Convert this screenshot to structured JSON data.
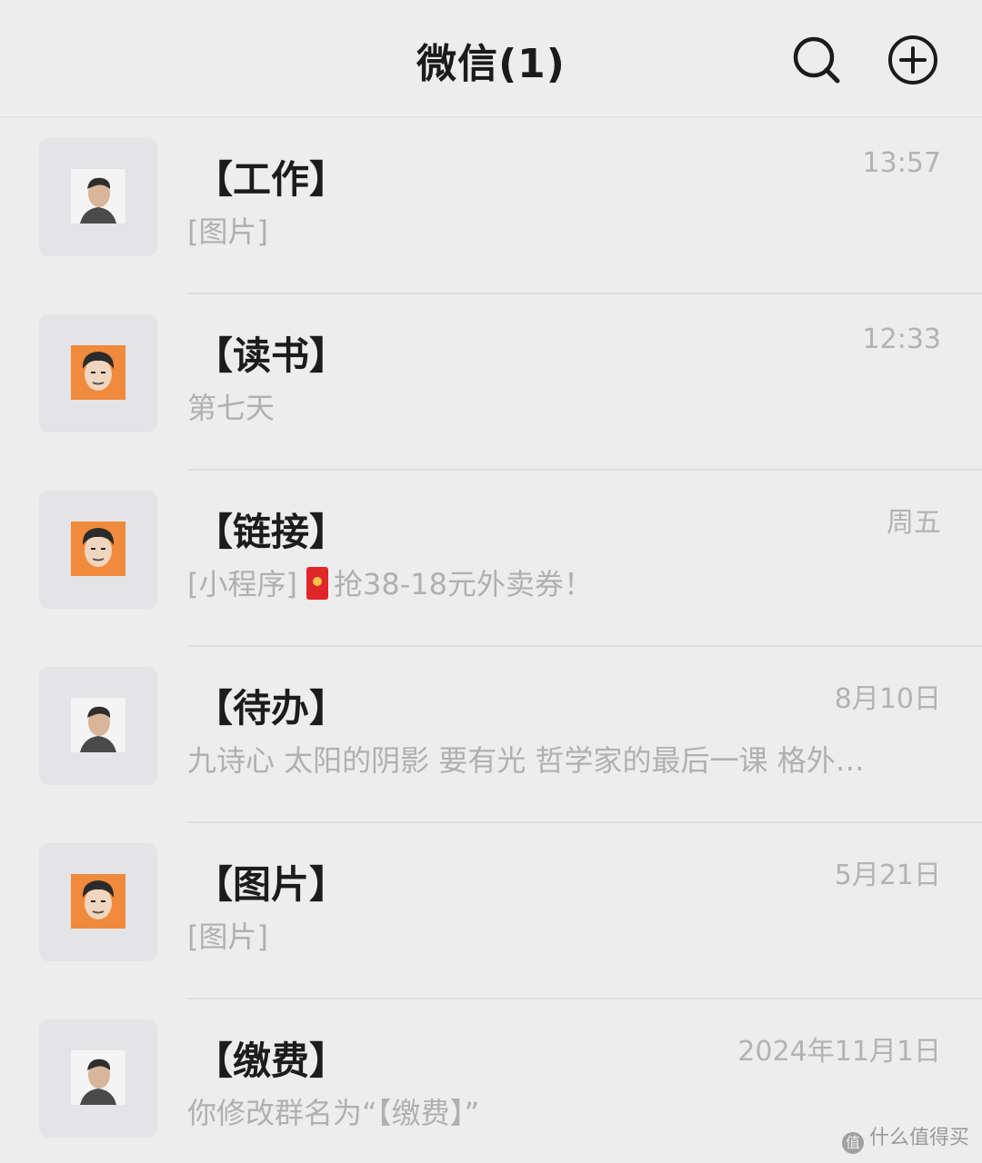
{
  "header": {
    "title": "微信(1)",
    "search_icon": "search-icon",
    "add_icon": "plus-circle-icon"
  },
  "chats": [
    {
      "name": "【工作】",
      "time": "13:57",
      "preview": "[图片]",
      "avatar": "gray"
    },
    {
      "name": "【读书】",
      "time": "12:33",
      "preview": "第七天",
      "avatar": "orange"
    },
    {
      "name": "【链接】",
      "time": "周五",
      "preview_prefix": "[小程序]",
      "preview": "抢38-18元外卖券！",
      "avatar": "orange",
      "icon": "red-packet-icon"
    },
    {
      "name": "【待办】",
      "time": "8月10日",
      "preview": "九诗心 太阳的阴影 要有光 哲学家的最后一课 格外…",
      "avatar": "gray"
    },
    {
      "name": "【图片】",
      "time": "5月21日",
      "preview": "[图片]",
      "avatar": "orange"
    },
    {
      "name": "【缴费】",
      "time": "2024年11月1日",
      "preview": "你修改群名为“【缴费】”",
      "avatar": "gray"
    }
  ],
  "watermark": {
    "text": "什么值得买",
    "icon_text": "值"
  },
  "colors": {
    "background": "#ededed",
    "avatar_orange": "#f08a3c",
    "red_packet": "#e0252b"
  }
}
